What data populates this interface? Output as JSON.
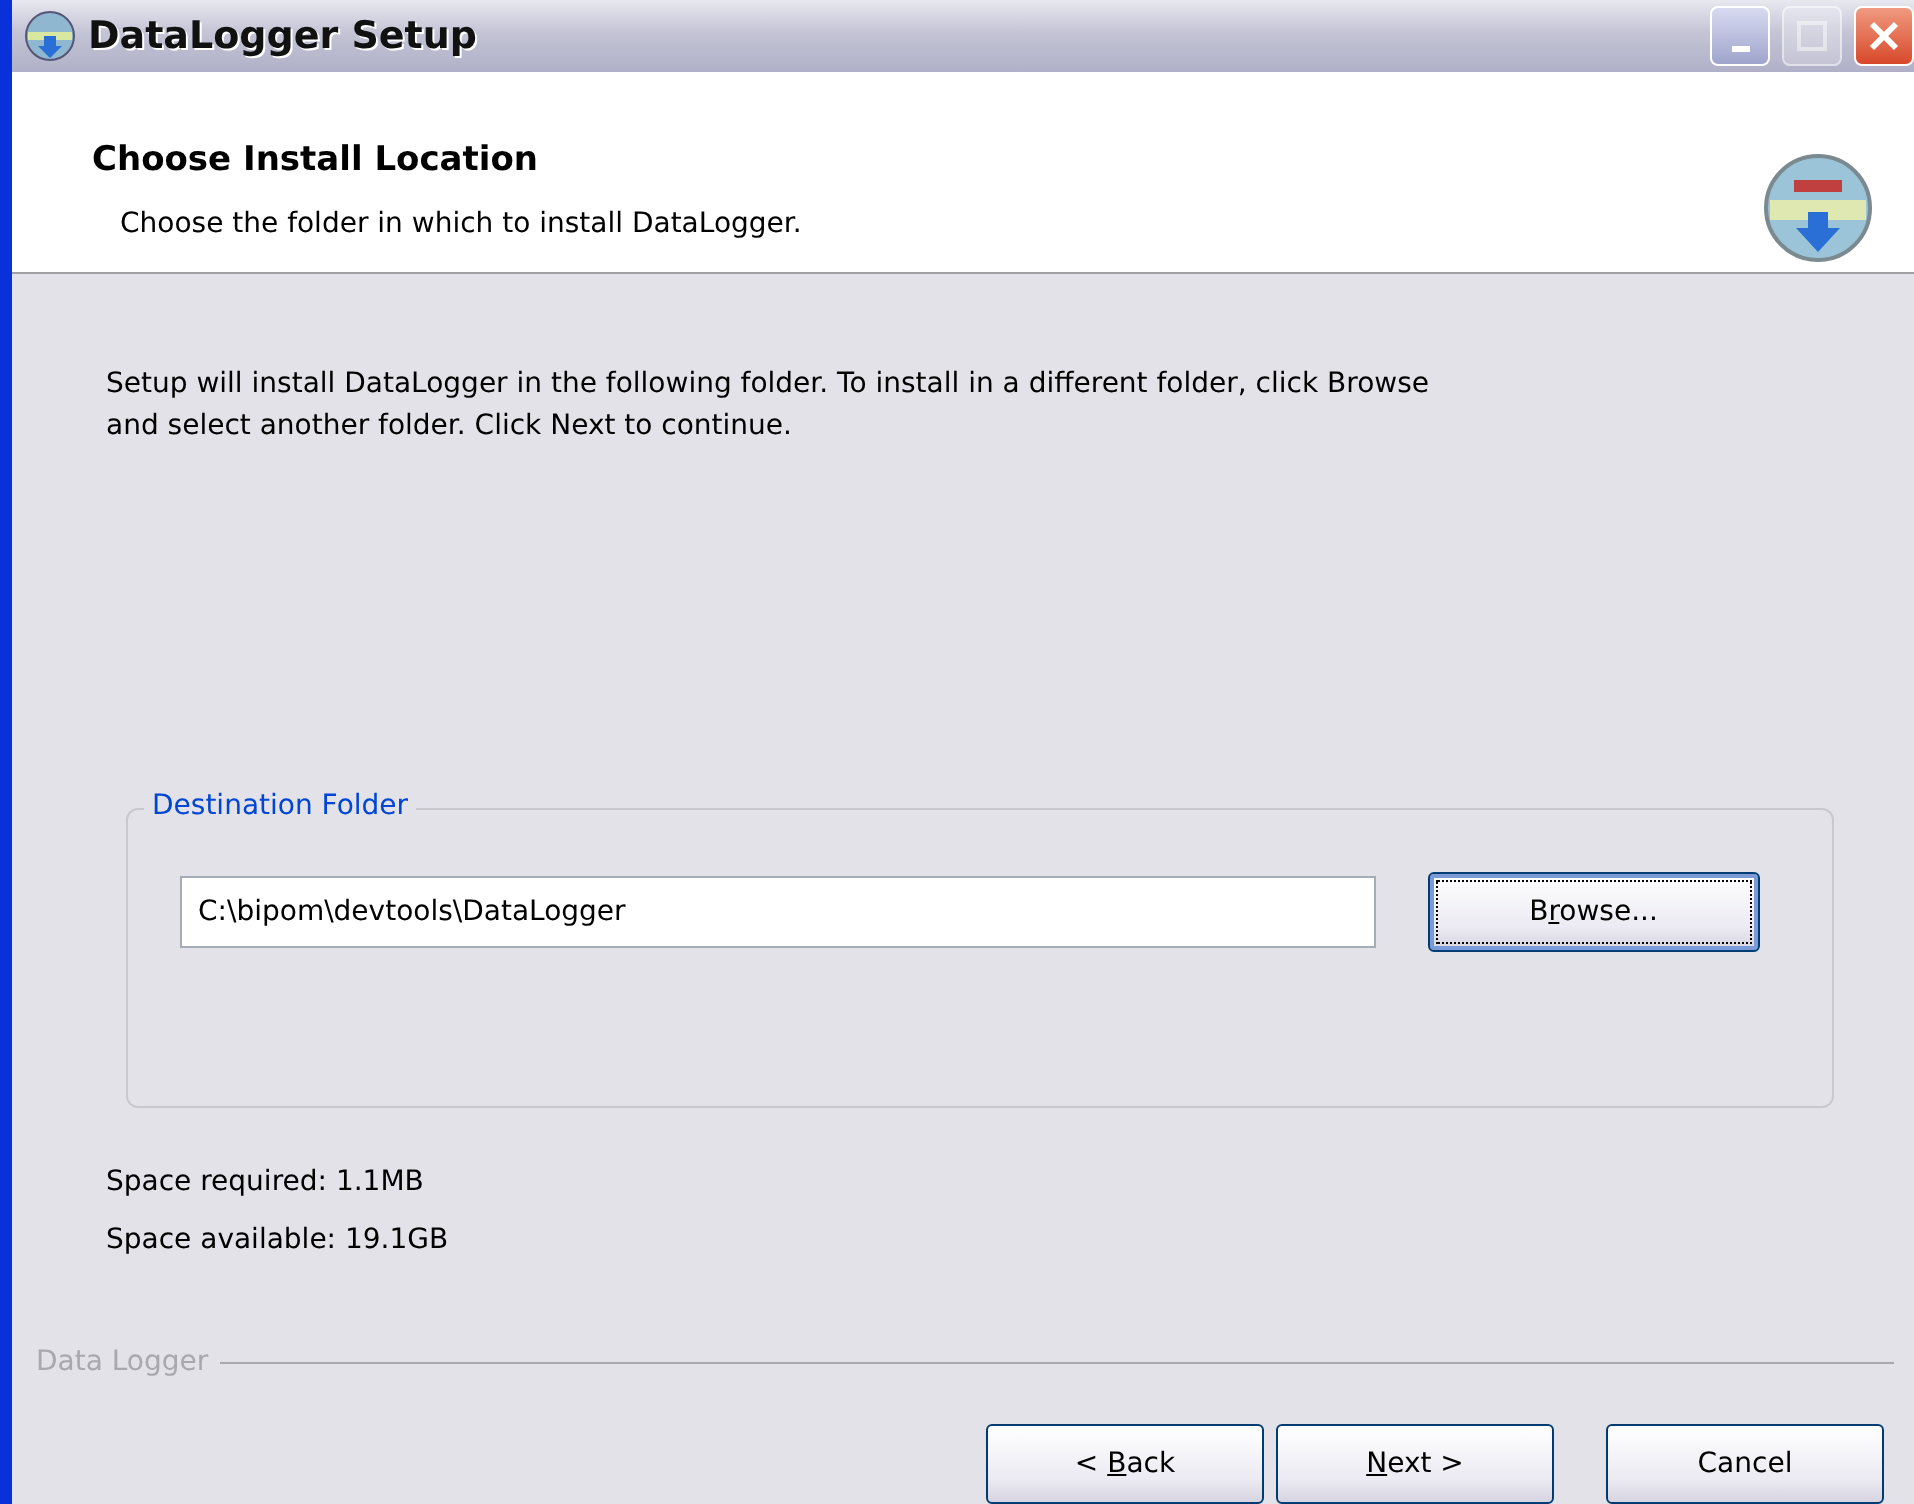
{
  "window": {
    "title": "DataLogger Setup",
    "controls": [
      {
        "kind": "minimize",
        "disabled": false
      },
      {
        "kind": "maximize",
        "disabled": true
      },
      {
        "kind": "close",
        "disabled": false
      }
    ]
  },
  "header": {
    "title": "Choose Install Location",
    "subtitle": "Choose the folder in which to install DataLogger."
  },
  "intro": "Setup will install DataLogger in the following folder. To install in a different folder, click Browse and select another folder. Click Next to continue.",
  "destination": {
    "legend": "Destination Folder",
    "value": "C:\\bipom\\devtools\\DataLogger",
    "browse": {
      "before": "B",
      "accel": "r",
      "after": "owse...",
      "focused": true
    }
  },
  "space_required": "Space required: 1.1MB",
  "space_available": "Space available: 19.1GB",
  "branding": "Data Logger",
  "buttons": [
    {
      "before": "< ",
      "accel": "B",
      "after": "ack"
    },
    {
      "accel": "N",
      "after": "ext >"
    },
    {
      "before": "Cancel"
    }
  ]
}
